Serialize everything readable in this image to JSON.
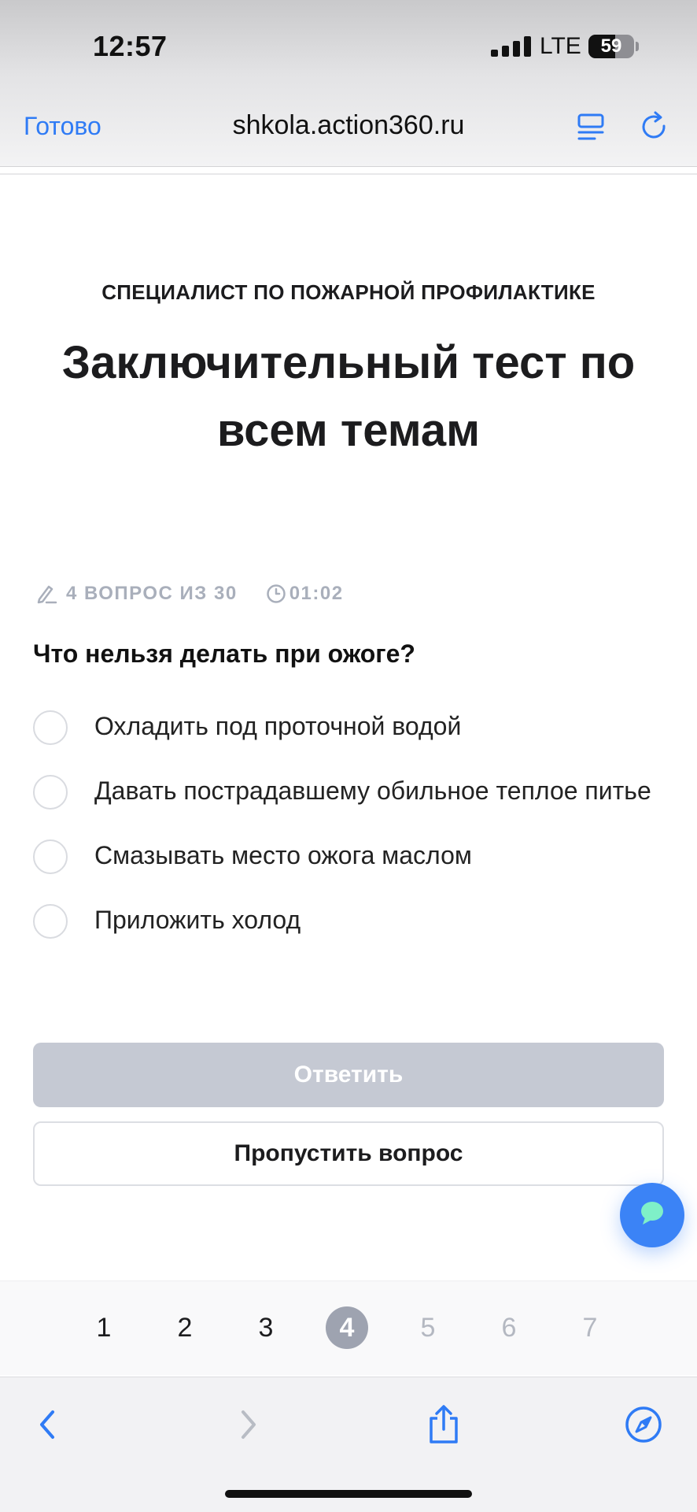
{
  "status_bar": {
    "time": "12:57",
    "network": "LTE",
    "battery": "59"
  },
  "browser": {
    "done_label": "Готово",
    "url": "shkola.action360.ru"
  },
  "test": {
    "course": "СПЕЦИАЛИСТ ПО ПОЖАРНОЙ ПРОФИЛАКТИКЕ",
    "title": "Заключительный тест по всем темам",
    "progress": "4 ВОПРОС ИЗ 30",
    "timer": "01:02",
    "question": "Что нельзя делать при ожоге?",
    "options": [
      "Охладить под проточной водой",
      "Давать пострадавшему обильное теплое питье",
      "Смазывать место ожога маслом",
      "Приложить холод"
    ],
    "answer_label": "Ответить",
    "skip_label": "Пропустить вопрос"
  },
  "pagination": {
    "pages": [
      "1",
      "2",
      "3",
      "4",
      "5",
      "6",
      "7"
    ],
    "current": "4"
  },
  "icons": {
    "reader": "reader-icon",
    "reload": "reload-icon",
    "pencil": "pencil-icon",
    "clock": "clock-icon",
    "chat": "chat-icon",
    "back": "back-icon",
    "forward": "forward-icon",
    "share": "share-icon",
    "compass": "compass-icon"
  },
  "colors": {
    "accent": "#2f7bf5",
    "disabled_button": "#c5c9d3",
    "active_page": "#9ea3b0",
    "chat_button": "#3b83f6"
  }
}
